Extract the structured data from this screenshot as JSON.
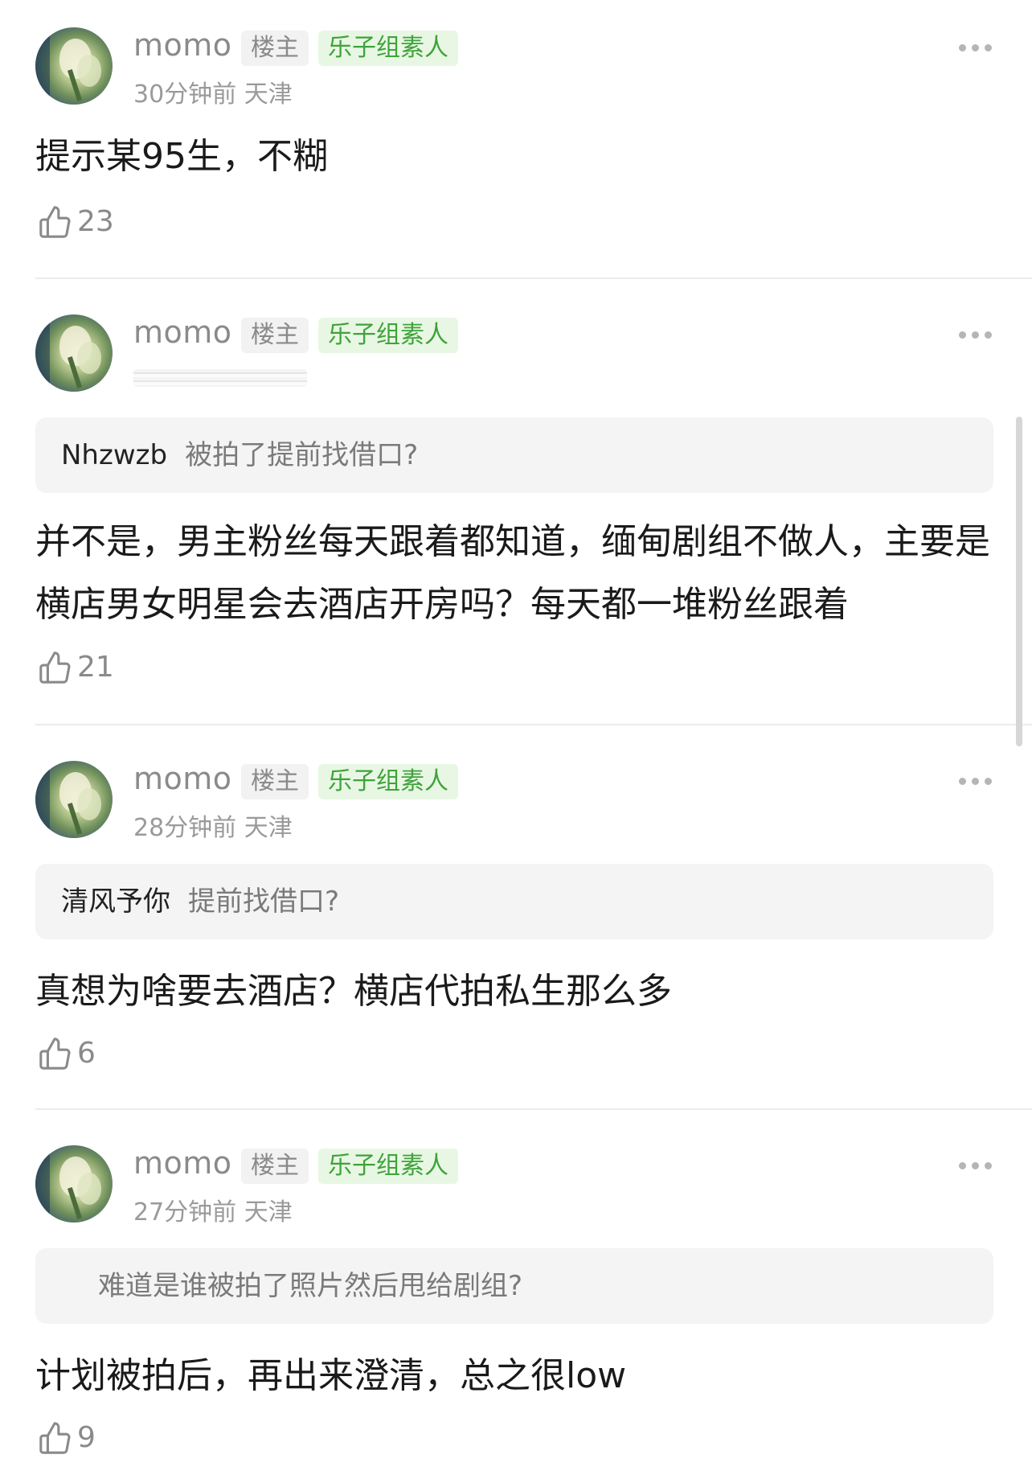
{
  "comments": [
    {
      "user": "momo",
      "op_tag": "楼主",
      "group_tag": "乐子组素人",
      "meta": "30分钟前 天津",
      "quote": null,
      "text": "提示某95生，不糊",
      "likes": "23"
    },
    {
      "user": "momo",
      "op_tag": "楼主",
      "group_tag": "乐子组素人",
      "meta": "",
      "quote": {
        "user": "Nhzwzb",
        "text": "被拍了提前找借口?"
      },
      "text": "并不是，男主粉丝每天跟着都知道，缅甸剧组不做人，主要是横店男女明星会去酒店开房吗？每天都一堆粉丝跟着",
      "likes": "21"
    },
    {
      "user": "momo",
      "op_tag": "楼主",
      "group_tag": "乐子组素人",
      "meta": "28分钟前 天津",
      "quote": {
        "user": "清风予你",
        "text": "提前找借口?"
      },
      "text": "真想为啥要去酒店？横店代拍私生那么多",
      "likes": "6"
    },
    {
      "user": "momo",
      "op_tag": "楼主",
      "group_tag": "乐子组素人",
      "meta": "27分钟前 天津",
      "quote": {
        "user": "",
        "text": "难道是谁被拍了照片然后甩给剧组?"
      },
      "text": "计划被拍后，再出来澄清，总之很low",
      "likes": "9"
    }
  ],
  "colors": {
    "accent_green": "#3fa33a",
    "tag_green_bg": "#e8f7e4",
    "muted": "#8a8a8a"
  },
  "icons": {
    "like": "thumbs-up-icon",
    "more": "more-dots-icon"
  }
}
